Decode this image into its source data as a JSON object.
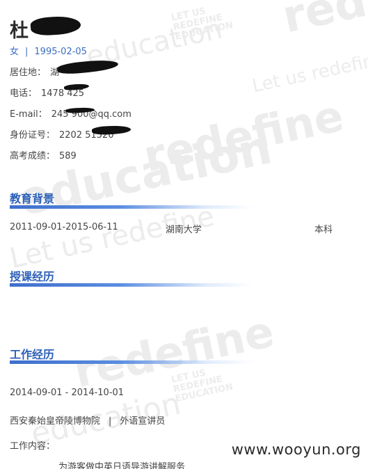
{
  "profile": {
    "name": "杜",
    "gender": "女",
    "separator": "|",
    "birth_date": "1995-02-05"
  },
  "info": [
    {
      "label": "居住地：",
      "value": "湖"
    },
    {
      "label": "电话：",
      "value": "1478     425"
    },
    {
      "label": "E-mail：",
      "value": "245       900@qq.com"
    },
    {
      "label": "身份证号：",
      "value": "2202       51520"
    },
    {
      "label": "高考成绩：",
      "value": "589"
    }
  ],
  "education": {
    "title": "教育背景",
    "rows": [
      {
        "period": "2011-09-01-2015-06-11",
        "school": "湖南大学",
        "degree": "本科"
      }
    ]
  },
  "teaching": {
    "title": "授课经历"
  },
  "work": {
    "title": "工作经历",
    "period": "2014-09-01 - 2014-10-01",
    "company": "西安秦始皇帝陵博物院",
    "separator": "|",
    "position": "外语宣讲员",
    "content_label": "工作内容：",
    "duty": "为游客做中英日语导游讲解服务"
  },
  "watermark": {
    "line1": "redefine",
    "line2": "Let us redefine",
    "line3": "education",
    "block": "LET US REDEFINE EDUCATION",
    "site": "www.wooyun.org"
  },
  "colors": {
    "accent": "#2b5fb8",
    "text": "#333333",
    "watermark": "#ececec"
  }
}
